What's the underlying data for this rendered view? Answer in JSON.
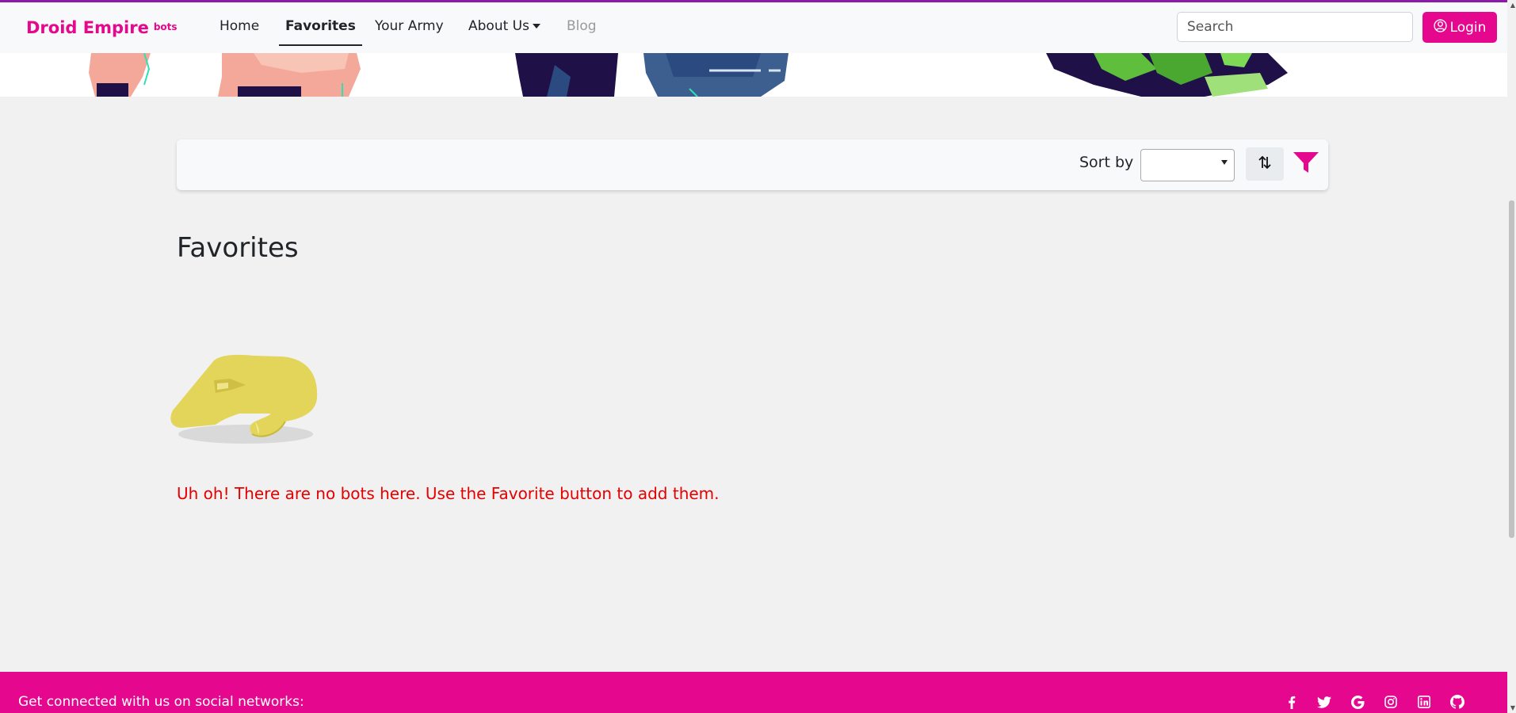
{
  "navbar": {
    "brand": "Droid Empire",
    "brand_sub": "bots",
    "links": [
      {
        "label": "Home",
        "state": "normal"
      },
      {
        "label": "Favorites",
        "state": "active"
      },
      {
        "label": "Your Army",
        "state": "normal"
      },
      {
        "label": "About Us",
        "state": "dropdown"
      },
      {
        "label": "Blog",
        "state": "disabled"
      }
    ],
    "search_placeholder": "Search",
    "login_label": "Login"
  },
  "toolbar": {
    "sort_label": "Sort by",
    "sort_value": "",
    "sort_order_icon": "sort-arrows-icon",
    "filter_icon": "filter-funnel-icon"
  },
  "main": {
    "title": "Favorites",
    "empty_message": "Uh oh! There are no bots here. Use the Favorite button to add them."
  },
  "footer": {
    "text": "Get connected with us on social networks:",
    "social_icons": [
      "facebook-icon",
      "twitter-icon",
      "google-icon",
      "instagram-icon",
      "linkedin-icon",
      "github-icon"
    ]
  },
  "colors": {
    "brand": "#e5088f",
    "top_border": "#8a1aa8",
    "error_text": "#e60000",
    "page_bg": "#f1f1f1",
    "hand": "#e3d45a"
  }
}
